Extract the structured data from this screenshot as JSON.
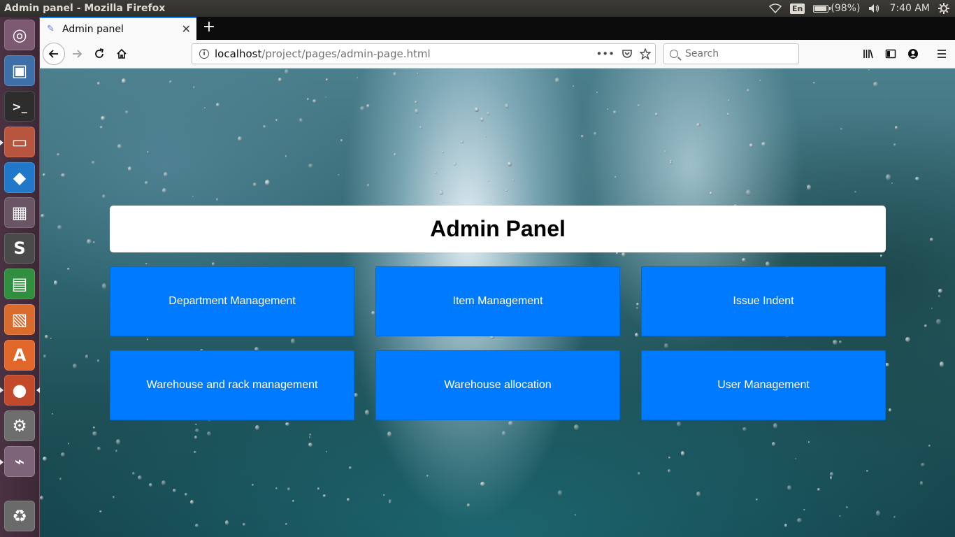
{
  "os": {
    "window_title": "Admin panel - Mozilla Firefox",
    "tray": {
      "language": "En",
      "battery": "(98%)",
      "battery_level": 0.98,
      "time": "7:40 AM"
    },
    "launcher": [
      {
        "name": "ubuntu-dash-icon",
        "color": "#7e5a72"
      },
      {
        "name": "image-viewer-icon",
        "color": "#3f6fa8"
      },
      {
        "name": "terminal-icon",
        "color": "#2d2d2d"
      },
      {
        "name": "file-manager-icon",
        "color": "#b8553f"
      },
      {
        "name": "vscode-icon",
        "color": "#2278c8"
      },
      {
        "name": "sticky-notes-icon",
        "color": "#6a5565"
      },
      {
        "name": "sublime-text-icon",
        "color": "#4a4a4a"
      },
      {
        "name": "spreadsheet-icon",
        "color": "#2f8f3f"
      },
      {
        "name": "presentation-icon",
        "color": "#d96b2c"
      },
      {
        "name": "software-center-icon",
        "color": "#e0662a"
      },
      {
        "name": "firefox-icon",
        "color": "#c24a2a"
      },
      {
        "name": "system-settings-icon",
        "color": "#6e6e6e"
      },
      {
        "name": "usb-drive-icon",
        "color": "#7d6478"
      },
      {
        "name": "trash-icon",
        "color": "#6a6a6a"
      }
    ]
  },
  "browser": {
    "tab_title": "Admin panel",
    "new_tab_label": "+",
    "url_host": "localhost",
    "url_path": "/project/pages/admin-page.html",
    "search_placeholder": "Search"
  },
  "page": {
    "title": "Admin Panel",
    "buttons": [
      "Department Management",
      "Item Management",
      "Issue Indent",
      "Warehouse and rack management",
      "Warehouse allocation",
      "User Management"
    ],
    "button_color": "#007bff"
  }
}
